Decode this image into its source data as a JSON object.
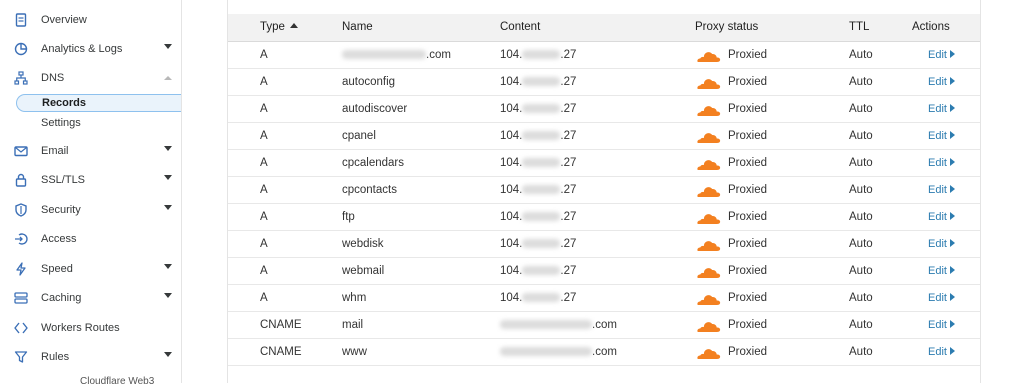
{
  "sidebar": {
    "items": [
      {
        "label": "Overview",
        "icon": "document-icon",
        "caret": false
      },
      {
        "label": "Analytics & Logs",
        "icon": "pie-chart-icon",
        "caret": true
      },
      {
        "label": "DNS",
        "icon": "network-icon",
        "caret": "up"
      },
      {
        "label": "Email",
        "icon": "envelope-icon",
        "caret": true
      },
      {
        "label": "SSL/TLS",
        "icon": "lock-icon",
        "caret": true
      },
      {
        "label": "Security",
        "icon": "shield-icon",
        "caret": true
      },
      {
        "label": "Access",
        "icon": "access-icon",
        "caret": false
      },
      {
        "label": "Speed",
        "icon": "lightning-icon",
        "caret": true
      },
      {
        "label": "Caching",
        "icon": "server-icon",
        "caret": true
      },
      {
        "label": "Workers Routes",
        "icon": "workers-icon",
        "caret": false
      },
      {
        "label": "Rules",
        "icon": "funnel-icon",
        "caret": true
      }
    ],
    "dns_sub": [
      {
        "label": "Records",
        "active": true
      },
      {
        "label": "Settings",
        "active": false
      }
    ],
    "partial_bottom": "Cloudflare Web3"
  },
  "table": {
    "headers": {
      "type": "Type",
      "name": "Name",
      "content": "Content",
      "proxy": "Proxy status",
      "ttl": "TTL",
      "actions": "Actions"
    },
    "rows": [
      {
        "type": "A",
        "name": ".com",
        "name_redacted": true,
        "content": "104.",
        "content_suffix": ".27",
        "proxy": "Proxied",
        "ttl": "Auto",
        "action": "Edit"
      },
      {
        "type": "A",
        "name": "autoconfig",
        "content": "104.",
        "content_suffix": ".27",
        "proxy": "Proxied",
        "ttl": "Auto",
        "action": "Edit"
      },
      {
        "type": "A",
        "name": "autodiscover",
        "content": "104.",
        "content_suffix": ".27",
        "proxy": "Proxied",
        "ttl": "Auto",
        "action": "Edit"
      },
      {
        "type": "A",
        "name": "cpanel",
        "content": "104.",
        "content_suffix": ".27",
        "proxy": "Proxied",
        "ttl": "Auto",
        "action": "Edit"
      },
      {
        "type": "A",
        "name": "cpcalendars",
        "content": "104.",
        "content_suffix": ".27",
        "proxy": "Proxied",
        "ttl": "Auto",
        "action": "Edit"
      },
      {
        "type": "A",
        "name": "cpcontacts",
        "content": "104.",
        "content_suffix": ".27",
        "proxy": "Proxied",
        "ttl": "Auto",
        "action": "Edit"
      },
      {
        "type": "A",
        "name": "ftp",
        "content": "104.",
        "content_suffix": ".27",
        "proxy": "Proxied",
        "ttl": "Auto",
        "action": "Edit"
      },
      {
        "type": "A",
        "name": "webdisk",
        "content": "104.",
        "content_suffix": ".27",
        "proxy": "Proxied",
        "ttl": "Auto",
        "action": "Edit"
      },
      {
        "type": "A",
        "name": "webmail",
        "content": "104.",
        "content_suffix": ".27",
        "proxy": "Proxied",
        "ttl": "Auto",
        "action": "Edit"
      },
      {
        "type": "A",
        "name": "whm",
        "content": "104.",
        "content_suffix": ".27",
        "proxy": "Proxied",
        "ttl": "Auto",
        "action": "Edit"
      },
      {
        "type": "CNAME",
        "name": "mail",
        "content": "",
        "content_suffix": ".com",
        "content_redacted": true,
        "proxy": "Proxied",
        "ttl": "Auto",
        "action": "Edit"
      },
      {
        "type": "CNAME",
        "name": "www",
        "content": "",
        "content_suffix": ".com",
        "content_redacted": true,
        "proxy": "Proxied",
        "ttl": "Auto",
        "action": "Edit"
      }
    ]
  },
  "colors": {
    "proxied_cloud": "#f38020",
    "link": "#2c7cb0",
    "active_bg": "#eaf3fb"
  }
}
